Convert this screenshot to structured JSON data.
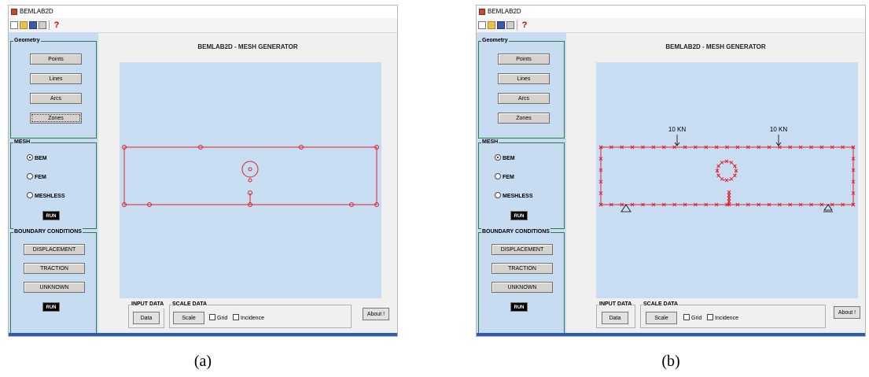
{
  "windows": [
    {
      "title": "BEMLAB2D",
      "geometry_group": "Geometry",
      "geometry_buttons": [
        "Points",
        "Lines",
        "Arcs",
        "Zones"
      ],
      "mesh_group": "MESH",
      "mesh_options": [
        "BEM",
        "FEM",
        "MESHLESS"
      ],
      "mesh_selected": "BEM",
      "mesh_run": "RUN",
      "bc_group": "BOUNDARY CONDITIONS",
      "bc_buttons": [
        "DISPLACEMENT",
        "TRACTION",
        "UNKNOWN"
      ],
      "bc_run": "RUN",
      "main_title": "BEMLAB2D - MESH GENERATOR",
      "input_data_title": "INPUT DATA",
      "data_button": "Data",
      "scale_data_title": "SCALE DATA",
      "scale_button": "Scale",
      "grid_label": "Grid",
      "incidence_label": "Incidence",
      "about_button": "About !",
      "load_labels": []
    },
    {
      "title": "BEMLAB2D",
      "geometry_group": "Geometry",
      "geometry_buttons": [
        "Points",
        "Lines",
        "Arcs",
        "Zones"
      ],
      "mesh_group": "MESH",
      "mesh_options": [
        "BEM",
        "FEM",
        "MESHLESS"
      ],
      "mesh_selected": "BEM",
      "mesh_run": "RUN",
      "bc_group": "BOUNDARY CONDITIONS",
      "bc_buttons": [
        "DISPLACEMENT",
        "TRACTION",
        "UNKNOWN"
      ],
      "bc_run": "RUN",
      "main_title": "BEMLAB2D - MESH GENERATOR",
      "input_data_title": "INPUT DATA",
      "data_button": "Data",
      "scale_data_title": "SCALE DATA",
      "scale_button": "Scale",
      "grid_label": "Grid",
      "incidence_label": "Incidence",
      "about_button": "About !",
      "load_labels": [
        "10 KN",
        "10 KN"
      ]
    }
  ],
  "captions": [
    "(a)",
    "(b)"
  ],
  "colors": {
    "panel_bg": "#c7dcf1",
    "plot_bg": "#c8dcf2",
    "geometry_red": "#e0202a",
    "group_border": "#2f7a4a"
  }
}
